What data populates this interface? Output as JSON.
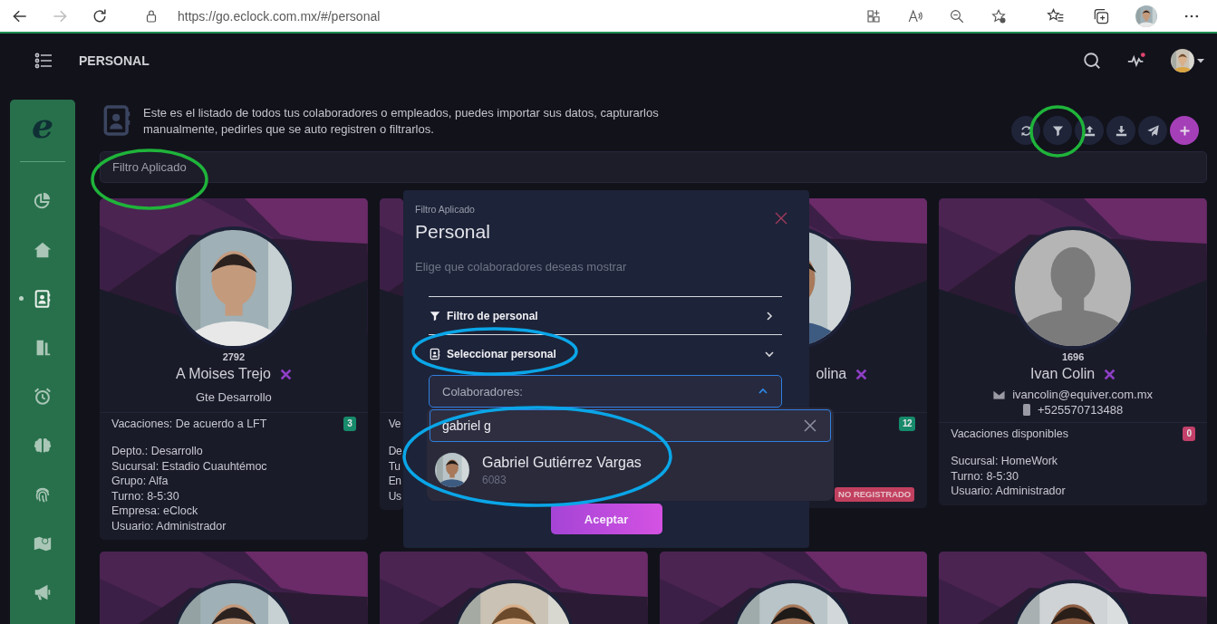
{
  "browser": {
    "url": "https://go.eclock.com.mx/#/personal",
    "forward_disabled": true
  },
  "header": {
    "title": "PERSONAL",
    "activity_alert": true
  },
  "sidebar": {
    "logo": "e",
    "items": [
      {
        "kind": "chart",
        "selected": false
      },
      {
        "kind": "home",
        "selected": false
      },
      {
        "kind": "contacts",
        "selected": true
      },
      {
        "kind": "door",
        "selected": false
      },
      {
        "kind": "alarm",
        "selected": false
      },
      {
        "kind": "brain",
        "selected": false
      },
      {
        "kind": "fingerprint",
        "selected": false
      },
      {
        "kind": "map",
        "selected": false
      },
      {
        "kind": "megaphone",
        "selected": false
      }
    ]
  },
  "intro": {
    "text": "Este es el listado de todos tus colaboradores o empleados, puedes importar sus datos, capturarlos manualmente, pedirles que se auto registren o filtrarlos."
  },
  "toolbar": [
    {
      "kind": "refresh"
    },
    {
      "kind": "filter"
    },
    {
      "kind": "upload"
    },
    {
      "kind": "download"
    },
    {
      "kind": "send"
    },
    {
      "kind": "add"
    }
  ],
  "filter_bar": {
    "label": "Filtro Aplicado"
  },
  "cards": [
    {
      "kind": "full",
      "default_avatar": false,
      "number": "2792",
      "name": "A Moises Trejo",
      "position": "Gte Desarrollo",
      "vacation": "Vacaciones: De acuerdo a LFT",
      "vacation_badge": {
        "text": "3",
        "color": "#168a6a"
      },
      "details": [
        "Depto.: Desarrollo",
        "Sucursal: Estadio Cuauhtémoc",
        "Grupo: Alfa",
        "Turno: 8-5:30",
        "Empresa: eClock",
        "Usuario: Administrador"
      ]
    },
    {
      "kind": "strip",
      "vacation": "Ve",
      "details": [
        "De",
        "Tu",
        "En",
        "Us"
      ]
    },
    {
      "kind": "covered",
      "default_avatar": false,
      "name": "olina",
      "vacation_badge": {
        "text": "12",
        "color": "#168a6a"
      },
      "status": "NO REGISTRADO"
    },
    {
      "kind": "full",
      "default_avatar": true,
      "number": "1696",
      "name": "Ivan Colin",
      "email": "ivancolin@equiver.com.mx",
      "phone": "+525570713488",
      "vacation": "Vacaciones disponibles",
      "vacation_badge": {
        "text": "0",
        "color": "#c2406a"
      },
      "details": [
        "Sucursal: HomeWork",
        "Turno: 8-5:30",
        "Usuario: Administrador"
      ]
    },
    {
      "kind": "full",
      "default_avatar": false
    },
    {
      "kind": "full",
      "default_avatar": false
    },
    {
      "kind": "full",
      "default_avatar": false
    },
    {
      "kind": "full",
      "default_avatar": false
    }
  ],
  "modal": {
    "eyebrow": "Filtro Aplicado",
    "title": "Personal",
    "subtitle": "Elige que colaboradores deseas mostrar",
    "sections": [
      {
        "kind": "filter",
        "label": "Filtro de personal",
        "expanded": false
      },
      {
        "kind": "contacts",
        "label": "Seleccionar personal",
        "expanded": true
      }
    ],
    "select": {
      "label": "Colaboradores:",
      "open": true
    },
    "search": {
      "value": "gabriel g"
    },
    "options": [
      {
        "name": "Gabriel Gutiérrez Vargas",
        "number": "6083"
      }
    ],
    "accept": "Aceptar"
  }
}
